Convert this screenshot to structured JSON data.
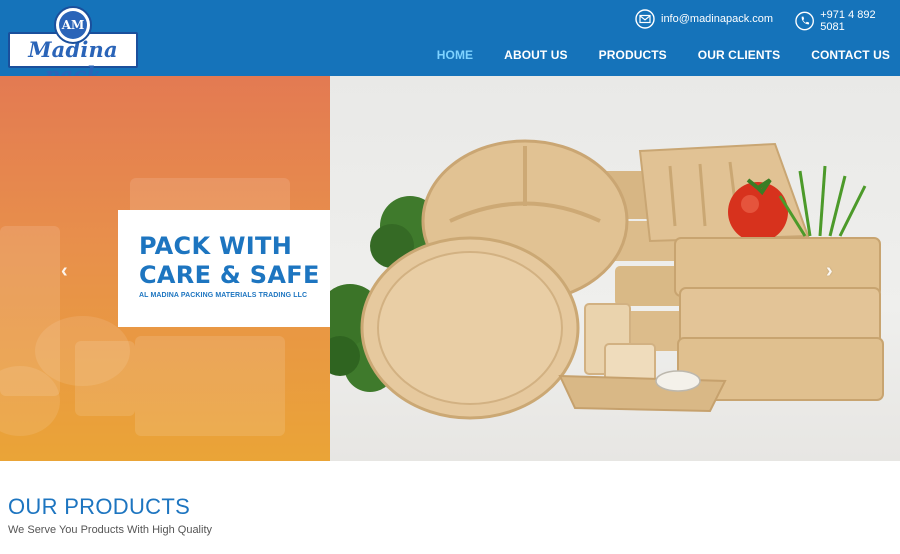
{
  "brand": {
    "logo_text": "Madina pack",
    "logo_initials": "AM"
  },
  "header": {
    "email": "info@madinapack.com",
    "phone": "+971 4 892 5081",
    "email_icon": "envelope-icon",
    "phone_icon": "phone-icon"
  },
  "nav": {
    "items": [
      {
        "label": "HOME",
        "active": true
      },
      {
        "label": "ABOUT US",
        "active": false
      },
      {
        "label": "PRODUCTS",
        "active": false
      },
      {
        "label": "OUR CLIENTS",
        "active": false
      },
      {
        "label": "CONTACT US",
        "active": false
      }
    ]
  },
  "hero": {
    "headline_line1": "PACK WITH",
    "headline_line2": "CARE & SAFE",
    "company": "AL MADINA PACKING MATERIALS TRADING LLC",
    "prev_icon": "chevron-left-icon",
    "next_icon": "chevron-right-icon"
  },
  "section": {
    "title": "OUR PRODUCTS",
    "subtitle": "We Serve You Products With High Quality"
  },
  "colors": {
    "header_bg": "#1573ba",
    "nav_active": "#7fd3ff",
    "accent_blue": "#1d75c0",
    "hero_orange": "#e8904b",
    "kraft": "#e3c497"
  }
}
